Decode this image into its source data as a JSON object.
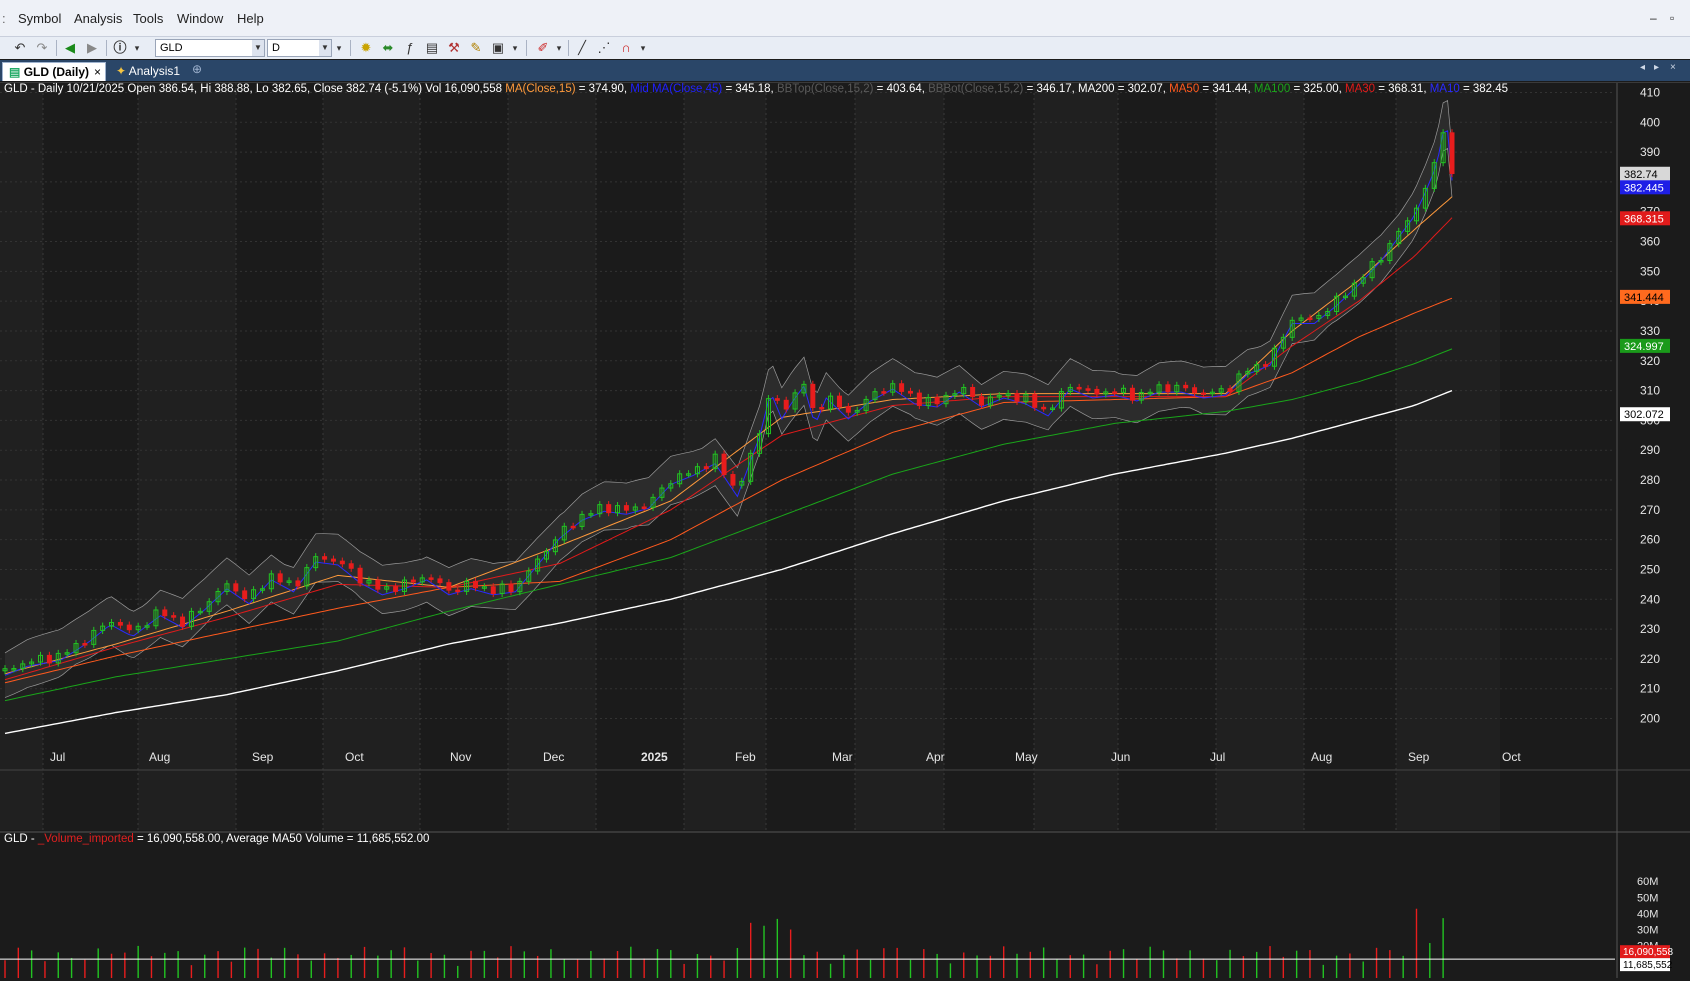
{
  "menu": [
    "Symbol",
    "Analysis",
    "Tools",
    "Window",
    "Help"
  ],
  "toolbar": {
    "symbol_value": "GLD",
    "interval_value": "D"
  },
  "tabs": {
    "chart_tab": "GLD (Daily)",
    "analysis_tab": "Analysis1"
  },
  "colors": {
    "up": "#22c322",
    "down": "#e81d1d",
    "ma15": "#ff9a3c",
    "midma": "#2020ff",
    "bb": "#9a9a9a",
    "ma200": "#ffffff",
    "ma50": "#ff5a1e",
    "ma100": "#1aa51a",
    "ma30": "#e21b1b",
    "ma10": "#2a2aff",
    "bg": "#1b1b1b"
  },
  "info": {
    "head": "GLD - Daily 10/21/2025 Open 386.54, Hi 388.88, Lo 382.65, Close 382.74 (-5.1%) Vol 16,090,558",
    "ma15_label": "MA(Close,15)",
    "ma15_val": " = 374.90, ",
    "midma_label": "Mid MA(Close,45)",
    "midma_val": " = 345.18, ",
    "bbtop_label": "BBTop(Close,15,2)",
    "bbtop_val": " = 403.64, ",
    "bbbot_label": "BBBot(Close,15,2)",
    "bbbot_val": " = 346.17, MA200 = 302.07, ",
    "ma50_label": "MA50",
    "ma50_val": " = 341.44, ",
    "ma100_label": "MA100",
    "ma100_val": " = 325.00, ",
    "ma30_label": "MA30",
    "ma30_val": " = 368.31, ",
    "ma10_label": "MA10",
    "ma10_val": " = 382.45"
  },
  "volume_info": {
    "prefix": "GLD - ",
    "name": "_Volume_imported",
    "rest": " = 16,090,558.00, Average MA50 Volume = 11,685,552.00"
  },
  "chart_data": {
    "type": "candlestick",
    "price_axis": {
      "ticks": [
        200,
        210,
        220,
        230,
        240,
        250,
        260,
        270,
        280,
        290,
        300,
        310,
        320,
        330,
        340,
        350,
        360,
        370,
        380,
        390,
        400,
        410
      ],
      "range": [
        190,
        413
      ]
    },
    "x_labels": [
      "Jul",
      "Aug",
      "Sep",
      "Oct",
      "Nov",
      "Dec",
      "2025",
      "Feb",
      "Mar",
      "Apr",
      "May",
      "Jun",
      "Jul",
      "Aug",
      "Sep",
      "Oct"
    ],
    "price_tags": [
      {
        "label": "382.74",
        "value": 382.74,
        "color": "#d8d8d8",
        "text": "#000000"
      },
      {
        "label": "382.445",
        "value": 378.2,
        "color": "#1e1ee6",
        "text": "#ffffff"
      },
      {
        "label": "368.315",
        "value": 367.8,
        "color": "#e11b1b",
        "text": "#ffffff"
      },
      {
        "label": "341.444",
        "value": 341.44,
        "color": "#ff6a1e",
        "text": "#000000"
      },
      {
        "label": "324.997",
        "value": 325.0,
        "color": "#1a9a1a",
        "text": "#ffffff"
      },
      {
        "label": "302.072",
        "value": 302.07,
        "color": "#ffffff",
        "text": "#000000"
      }
    ],
    "price_path": [
      [
        0,
        216
      ],
      [
        20,
        219
      ],
      [
        50,
        221
      ],
      [
        75,
        227
      ],
      [
        95,
        233
      ],
      [
        115,
        229
      ],
      [
        140,
        236
      ],
      [
        160,
        232
      ],
      [
        180,
        238
      ],
      [
        200,
        245
      ],
      [
        220,
        240
      ],
      [
        240,
        248
      ],
      [
        260,
        244
      ],
      [
        280,
        254
      ],
      [
        300,
        253
      ],
      [
        320,
        247
      ],
      [
        340,
        243
      ],
      [
        360,
        245
      ],
      [
        380,
        248
      ],
      [
        400,
        243
      ],
      [
        420,
        245
      ],
      [
        440,
        243
      ],
      [
        460,
        244
      ],
      [
        480,
        253
      ],
      [
        500,
        262
      ],
      [
        520,
        268
      ],
      [
        540,
        271
      ],
      [
        560,
        270
      ],
      [
        580,
        272
      ],
      [
        600,
        280
      ],
      [
        620,
        283
      ],
      [
        640,
        287
      ],
      [
        660,
        276
      ],
      [
        680,
        296
      ],
      [
        690,
        311
      ],
      [
        700,
        302
      ],
      [
        710,
        308
      ],
      [
        720,
        313
      ],
      [
        730,
        300
      ],
      [
        740,
        309
      ],
      [
        760,
        302
      ],
      [
        780,
        308
      ],
      [
        800,
        312
      ],
      [
        820,
        307
      ],
      [
        840,
        306
      ],
      [
        860,
        311
      ],
      [
        880,
        306
      ],
      [
        900,
        309
      ],
      [
        920,
        307
      ],
      [
        940,
        303
      ],
      [
        960,
        312
      ],
      [
        980,
        309
      ],
      [
        1000,
        310
      ],
      [
        1020,
        308
      ],
      [
        1040,
        311
      ],
      [
        1060,
        311
      ],
      [
        1080,
        309
      ],
      [
        1100,
        310
      ],
      [
        1120,
        317
      ],
      [
        1140,
        320
      ],
      [
        1160,
        334
      ],
      [
        1180,
        334
      ],
      [
        1200,
        340
      ],
      [
        1220,
        347
      ],
      [
        1240,
        355
      ],
      [
        1260,
        365
      ],
      [
        1270,
        370
      ],
      [
        1280,
        378
      ],
      [
        1290,
        387
      ],
      [
        1296,
        398
      ],
      [
        1299,
        402
      ],
      [
        1302,
        392
      ],
      [
        1304,
        382
      ]
    ],
    "moving_averages": {
      "MA200": [
        [
          0,
          195
        ],
        [
          100,
          202
        ],
        [
          200,
          208
        ],
        [
          300,
          216
        ],
        [
          400,
          225
        ],
        [
          500,
          232
        ],
        [
          600,
          240
        ],
        [
          700,
          250
        ],
        [
          800,
          262
        ],
        [
          900,
          273
        ],
        [
          1000,
          282
        ],
        [
          1100,
          289
        ],
        [
          1160,
          294
        ],
        [
          1220,
          300
        ],
        [
          1270,
          305
        ],
        [
          1304,
          310
        ]
      ],
      "MA100": [
        [
          0,
          206
        ],
        [
          100,
          214
        ],
        [
          200,
          220
        ],
        [
          300,
          226
        ],
        [
          400,
          236
        ],
        [
          500,
          245
        ],
        [
          600,
          254
        ],
        [
          700,
          268
        ],
        [
          800,
          282
        ],
        [
          900,
          292
        ],
        [
          1000,
          299
        ],
        [
          1100,
          303
        ],
        [
          1160,
          307
        ],
        [
          1220,
          313
        ],
        [
          1270,
          319
        ],
        [
          1304,
          324
        ]
      ],
      "MA50": [
        [
          0,
          212
        ],
        [
          100,
          221
        ],
        [
          200,
          229
        ],
        [
          300,
          237
        ],
        [
          400,
          244
        ],
        [
          500,
          246
        ],
        [
          600,
          260
        ],
        [
          700,
          280
        ],
        [
          800,
          296
        ],
        [
          900,
          306
        ],
        [
          1000,
          307
        ],
        [
          1100,
          308
        ],
        [
          1160,
          316
        ],
        [
          1220,
          328
        ],
        [
          1270,
          336
        ],
        [
          1304,
          341
        ]
      ],
      "MA30": [
        [
          0,
          213
        ],
        [
          100,
          224
        ],
        [
          200,
          234
        ],
        [
          300,
          245
        ],
        [
          400,
          244
        ],
        [
          500,
          252
        ],
        [
          600,
          270
        ],
        [
          700,
          295
        ],
        [
          800,
          305
        ],
        [
          900,
          308
        ],
        [
          1000,
          308
        ],
        [
          1100,
          308
        ],
        [
          1160,
          325
        ],
        [
          1220,
          340
        ],
        [
          1270,
          355
        ],
        [
          1304,
          368
        ]
      ],
      "MA15": [
        [
          0,
          215
        ],
        [
          100,
          225
        ],
        [
          200,
          236
        ],
        [
          300,
          248
        ],
        [
          400,
          244
        ],
        [
          500,
          258
        ],
        [
          600,
          273
        ],
        [
          700,
          301
        ],
        [
          800,
          307
        ],
        [
          900,
          309
        ],
        [
          1000,
          309
        ],
        [
          1100,
          309
        ],
        [
          1160,
          330
        ],
        [
          1220,
          347
        ],
        [
          1270,
          364
        ],
        [
          1304,
          375
        ]
      ]
    },
    "volume_axis": {
      "ticks": [
        "20M",
        "30M",
        "40M",
        "50M",
        "60M"
      ],
      "tag_current": "16,090,558",
      "tag_avg": "11,685,552"
    }
  }
}
